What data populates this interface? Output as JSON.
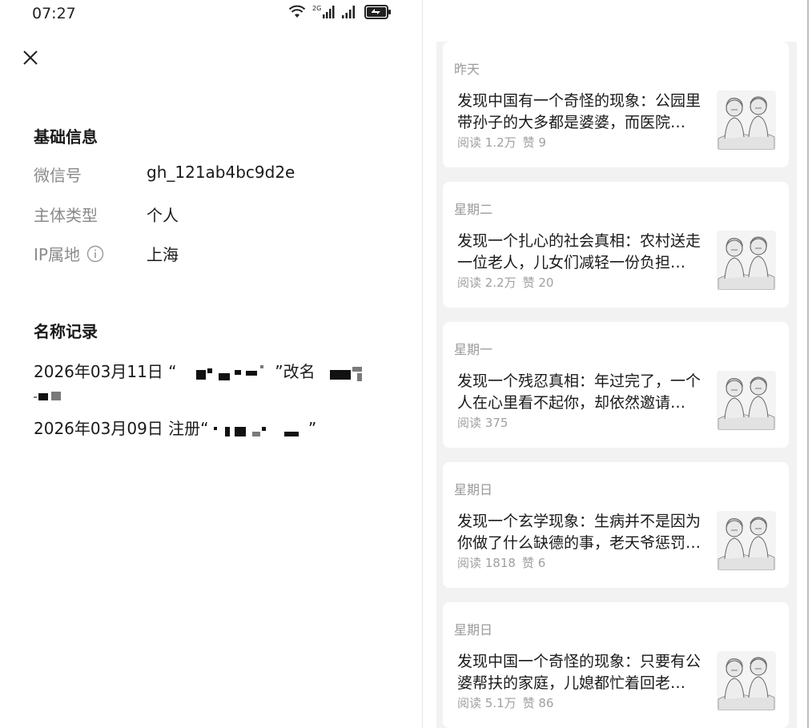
{
  "status_bar": {
    "time": "07:27",
    "icons": [
      "wifi-icon",
      "signal-2g-icon",
      "signal-icon",
      "battery-saver-icon"
    ],
    "network_label": "2G"
  },
  "colors": {
    "text_primary": "#1a1a1a",
    "text_secondary": "#8a8a8a",
    "panel_bg": "#f2f2f2",
    "card_bg": "#ffffff"
  },
  "basic_info": {
    "title": "基础信息",
    "rows": [
      {
        "label": "微信号",
        "value": "gh_121ab4bc9d2e"
      },
      {
        "label": "主体类型",
        "value": "个人"
      },
      {
        "label": "IP属地",
        "value": "上海"
      }
    ]
  },
  "name_records": {
    "title": "名称记录",
    "lines": [
      {
        "prefix": "2026年03月11日 “",
        "middle": "”改名"
      },
      {
        "prefix": "2026年03月09日 注册“",
        "suffix": "”"
      }
    ]
  },
  "articles": [
    {
      "day": "昨天",
      "title": "发现中国有一个奇怪的现象：公园里带孙子的大多都是婆婆，而医院…",
      "reads": "阅读 1.2万",
      "likes": "赞 9"
    },
    {
      "day": "星期二",
      "title": "发现一个扎心的社会真相：农村送走一位老人，儿女们减轻一份负担…",
      "reads": "阅读 2.2万",
      "likes": "赞 20"
    },
    {
      "day": "星期一",
      "title": "发现一个残忍真相：年过完了，一个人在心里看不起你，却依然邀请…",
      "reads": "阅读 375",
      "likes": ""
    },
    {
      "day": "星期日",
      "title": "发现一个玄学现象：生病并不是因为你做了什么缺德的事，老天爷惩罚…",
      "reads": "阅读 1818",
      "likes": "赞 6"
    },
    {
      "day": "星期日",
      "title": "发现中国一个奇怪的现象：只要有公婆帮扶的家庭，儿媳都忙着回老…",
      "reads": "阅读 5.1万",
      "likes": "赞 86"
    }
  ]
}
